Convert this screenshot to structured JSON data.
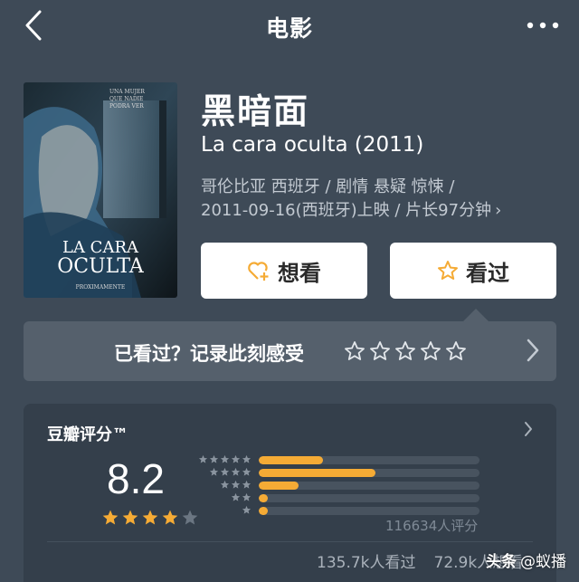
{
  "nav": {
    "title": "电影",
    "back_icon": "chevron-left-icon",
    "more_icon": "more-dots-icon"
  },
  "movie": {
    "title_cn": "黑暗面",
    "title_original": "La cara oculta (2011)",
    "meta_line1": "哥伦比亚 西班牙 / 剧情 悬疑 惊悚 /",
    "meta_line2": "2011-09-16(西班牙)上映 / 片长97分钟",
    "poster": {
      "title_line1": "LA CARA",
      "title_line2": "OCULTA",
      "tagline": "PROXIMAMENTE"
    }
  },
  "actions": {
    "want_label": "想看",
    "seen_label": "看过"
  },
  "rate_prompt": {
    "text": "已看过？记录此刻感受",
    "stars": 5
  },
  "score": {
    "label": "豆瓣评分™",
    "value": "8.2",
    "stars_filled": 4,
    "stars_total": 5,
    "distribution": [
      {
        "stars": 5,
        "fraction": 0.29
      },
      {
        "stars": 4,
        "fraction": 0.53
      },
      {
        "stars": 3,
        "fraction": 0.18
      },
      {
        "stars": 2,
        "fraction": 0.04
      },
      {
        "stars": 1,
        "fraction": 0.04
      }
    ],
    "rating_count": "116634人评分",
    "watched": "135.7k人看过",
    "want": "72.9k人想看"
  },
  "watermark": {
    "brand": "头条",
    "handle": "@蚁播"
  },
  "colors": {
    "background": "#3e4a57",
    "accent": "#f5ab35",
    "card": "#343f4b"
  }
}
